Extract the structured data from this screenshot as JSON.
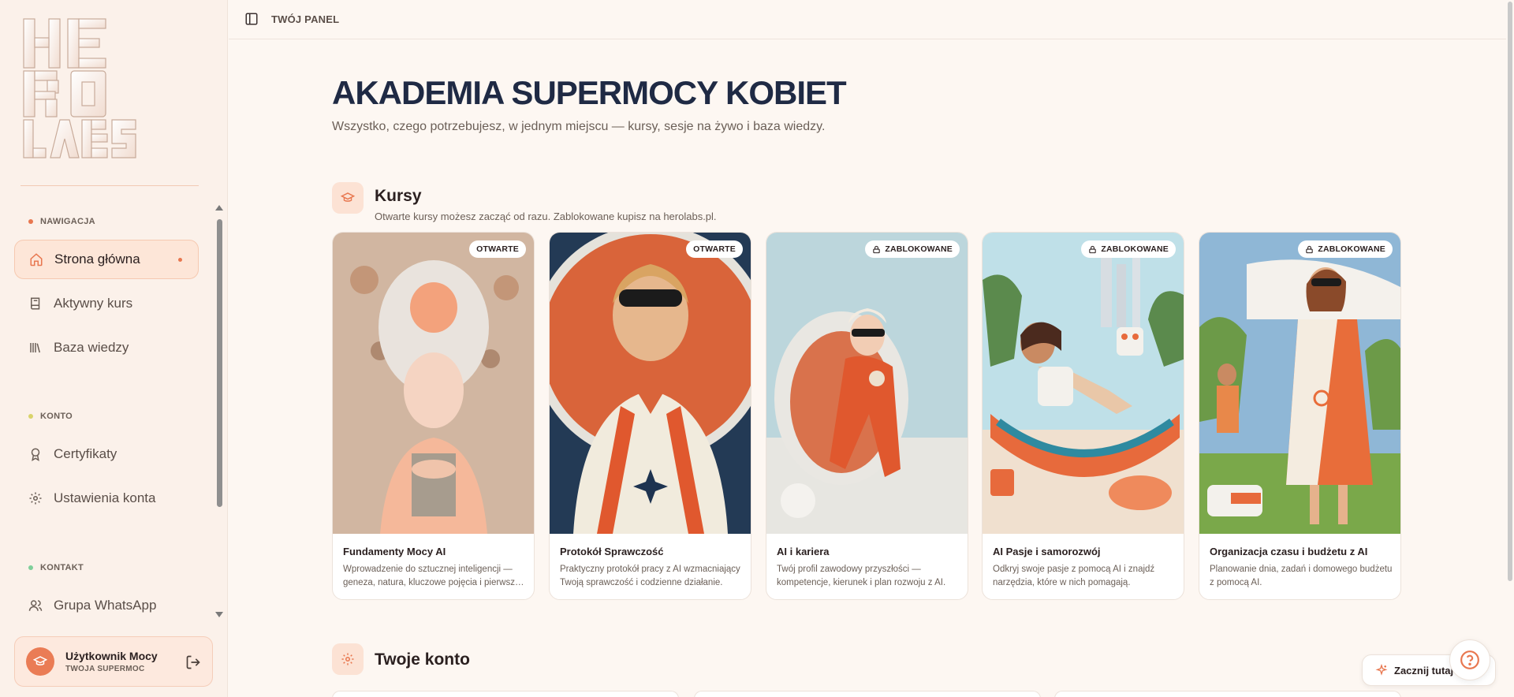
{
  "sidebar": {
    "logo_text": "HERO LABS",
    "sections": {
      "navigation": "NAWIGACJA",
      "account": "KONTO",
      "contact": "KONTAKT"
    },
    "items": {
      "home": "Strona główna",
      "active_course": "Aktywny kurs",
      "knowledge_base": "Baza wiedzy",
      "certificates": "Certyfikaty",
      "account_settings": "Ustawienia konta",
      "whatsapp_group": "Grupa WhatsApp"
    },
    "user": {
      "name": "Użytkownik Mocy",
      "role": "TWOJA SUPERMOC"
    }
  },
  "topbar": {
    "title": "TWÓJ PANEL"
  },
  "hero": {
    "title": "AKADEMIA SUPERMOCY KOBIET",
    "subtitle": "Wszystko, czego potrzebujesz, w jednym miejscu — kursy, sesje na żywo i baza wiedzy."
  },
  "courses_section": {
    "title": "Kursy",
    "description": "Otwarte kursy możesz zacząć od razu. Zablokowane kupisz na herolabs.pl."
  },
  "courses": [
    {
      "title": "Fundamenty Mocy AI",
      "description": "Wprowadzenie do sztucznej inteligencji — geneza, natura, kluczowe pojęcia i pierwsze kroki.",
      "badge": "OTWARTE",
      "locked": false
    },
    {
      "title": "Protokół Sprawczość",
      "description": "Praktyczny protokół pracy z AI wzmacniający Twoją sprawczość i codzienne działanie.",
      "badge": "OTWARTE",
      "locked": false
    },
    {
      "title": "AI i kariera",
      "description": "Twój profil zawodowy przyszłości — kompetencje, kierunek i plan rozwoju z AI.",
      "badge": "ZABLOKOWANE",
      "locked": true
    },
    {
      "title": "AI Pasje i samorozwój",
      "description": "Odkryj swoje pasje z pomocą AI i znajdź narzędzia, które w nich pomagają.",
      "badge": "ZABLOKOWANE",
      "locked": true
    },
    {
      "title": "Organizacja czasu i budżetu z AI",
      "description": "Planowanie dnia, zadań i domowego budżetu z pomocą AI.",
      "badge": "ZABLOKOWANE",
      "locked": true
    }
  ],
  "account_section": {
    "title": "Twoje konto"
  },
  "tour_button": "Zacznij tutaj",
  "colors": {
    "accent": "#e8774f",
    "navy": "#1f2a44",
    "background": "#fdf7f2"
  }
}
